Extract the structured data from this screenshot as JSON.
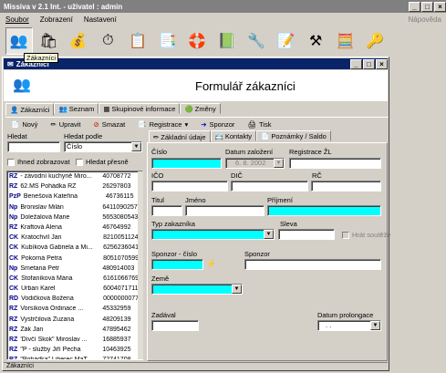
{
  "app": {
    "title": "Missiva v 2.1 Int. - uživatel : admin",
    "help": "Nápověda",
    "menu": [
      "Soubor",
      "Zobrazení",
      "Nastavení"
    ],
    "tooltip": "Zákazníci",
    "toolbar_icons": [
      "customers-icon",
      "bag-icon",
      "money-bag-icon",
      "clock-icon",
      "list-icon",
      "documents-icon",
      "lifebuoy-icon",
      "book-icon",
      "tools-icon",
      "notes-icon",
      "hammer-icon",
      "calculator-icon",
      "key-icon"
    ]
  },
  "child": {
    "title": "Zákazníci",
    "form_title": "Formulář zákazníci",
    "tabs": [
      "Zákazníci",
      "Seznam",
      "Skupinové informace",
      "Změny"
    ],
    "actions": {
      "new": "Nový",
      "edit": "Upravit",
      "delete": "Smazat",
      "registrace": "Registrace",
      "sponzor": "Sponzor",
      "tisk": "Tisk"
    },
    "search": {
      "hledat_label": "Hledat",
      "hledat_podle_label": "Hledat podle",
      "hledat_podle_value": "Číslo",
      "ihned_label": "Ihned zobrazovat",
      "presne_label": "Hledat přesně"
    },
    "list": [
      {
        "type": "RZ",
        "name": "- závodní kuchyně Miro...",
        "num": "40708772"
      },
      {
        "type": "RZ",
        "name": "62.MŠ Pohádka RZ",
        "num": "26297803"
      },
      {
        "type": "PzP",
        "name": "Benešová Kateřina",
        "num": "46736115"
      },
      {
        "type": "Np",
        "name": "Bronislav  Milán",
        "num": "6411090257"
      },
      {
        "type": "Np",
        "name": "Doležalová Marie",
        "num": "5653080543"
      },
      {
        "type": "RZ",
        "name": "Kraftová Alena",
        "num": "46764992"
      },
      {
        "type": "ČK",
        "name": "Kratochvíl Jan",
        "num": "8210051124"
      },
      {
        "type": "ČK",
        "name": "Kubíková Gabriela a Mi...",
        "num": "6256236041"
      },
      {
        "type": "ČK",
        "name": "Pokorná Petra",
        "num": "8051070599"
      },
      {
        "type": "Np",
        "name": "Smetana Petr",
        "num": "480914003"
      },
      {
        "type": "ČK",
        "name": "Štofaníková Mária",
        "num": "6161066769"
      },
      {
        "type": "ČK",
        "name": "Urban Karel",
        "num": "6004071711"
      },
      {
        "type": "RD",
        "name": "Vodičková Božena",
        "num": "0000000077"
      },
      {
        "type": "RZ",
        "name": "Vorsíková  Ordinace ...",
        "num": "45332959"
      },
      {
        "type": "RZ",
        "name": "Vystrčilová Zuzana",
        "num": "48209139"
      },
      {
        "type": "RZ",
        "name": "Žák Jan",
        "num": "47895462"
      },
      {
        "type": "RZ",
        "name": "'Dívčí Skok\" Miroslav ...",
        "num": "16885937"
      },
      {
        "type": "RZ",
        "name": "\"P - služby Jiří Pecha",
        "num": "10463925"
      },
      {
        "type": "RZ",
        "name": "\"Pohádka\" Liberec MaT",
        "num": "72741708"
      }
    ],
    "form_tabs": [
      "Základní údaje",
      "Kontakty",
      "Poznámky / Saldo"
    ],
    "form": {
      "cislo_label": "Číslo",
      "datum_zalozeni_label": "Datum založení",
      "datum_zalozeni_value": "6. 8. 2002",
      "registrace_zl_label": "Registrace ŽL",
      "ico_label": "IČO",
      "dic_label": "DIČ",
      "rc_label": "RČ",
      "titul_label": "Titul",
      "jmeno_label": "Jméno",
      "prijmeni_label": "Příjmení",
      "typ_label": "Typ zakazníka",
      "sleva_label": "Sleva",
      "hrat_label": "Hrát soutěže",
      "sponzor_cislo_label": "Sponzor - číslo",
      "sponzor_label": "Sponzor",
      "zeme_label": "Země",
      "zadaval_label": "Zadával",
      "datum_prolongace_label": "Datum prolongace",
      "datum_prolongace_value": ". ."
    },
    "status": "Zákazníci"
  },
  "colors": {
    "required": "#00ffff",
    "titlebar": "#0a246a"
  }
}
